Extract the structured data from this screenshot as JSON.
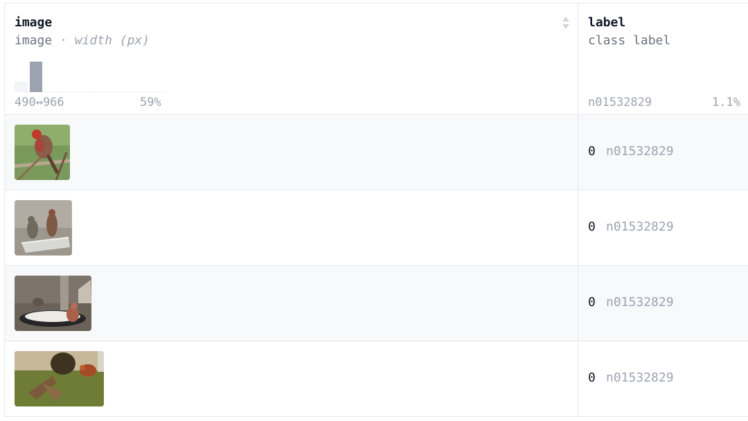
{
  "columns": {
    "image": {
      "name": "image",
      "type": "image",
      "separator": "·",
      "unit": "width (px)",
      "range": "490↔966",
      "top_percent": "59%",
      "histogram": [
        0.35,
        1.0,
        0.02,
        0.02,
        0.02,
        0.02,
        0.02,
        0.02,
        0.02,
        0.02
      ]
    },
    "label": {
      "name": "label",
      "type": "class label",
      "top_class": "n01532829",
      "top_percent": "1.1%"
    }
  },
  "rows": [
    {
      "class_value": "0",
      "class_name": "n01532829",
      "thumb_name": "finch-on-branch-thumbnail"
    },
    {
      "class_value": "0",
      "class_name": "n01532829",
      "thumb_name": "two-finches-on-feeder-thumbnail"
    },
    {
      "class_value": "0",
      "class_name": "n01532829",
      "thumb_name": "finch-at-bird-bath-thumbnail"
    },
    {
      "class_value": "0",
      "class_name": "n01532829",
      "thumb_name": "finches-flying-thumbnail"
    }
  ],
  "colors": {
    "hist_bar_main": "#9ca3af",
    "hist_bar_faint": "#f3f4f6",
    "row_alt": "#f8f9fb",
    "border": "#e5e7eb"
  }
}
